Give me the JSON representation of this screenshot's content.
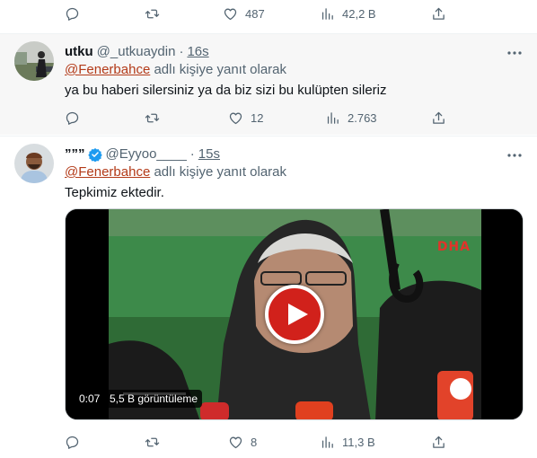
{
  "top_actions": {
    "replies": "",
    "retweets": "",
    "likes": "487",
    "views": "42,2 B"
  },
  "tweets": [
    {
      "name": "utku",
      "handle": "@_utkuaydin",
      "time": "16s",
      "reply_mention": "@Fenerbahce",
      "reply_suffix": " adlı kişiye yanıt olarak",
      "text": "ya bu haberi silersiniz ya da biz sizi bu kulüpten sileriz",
      "actions": {
        "replies": "",
        "retweets": "",
        "likes": "12",
        "views": "2.763"
      }
    },
    {
      "name": "”””",
      "handle": "@Eyyoo____",
      "time": "15s",
      "reply_mention": "@Fenerbahce",
      "reply_suffix": " adlı kişiye yanıt olarak",
      "text": "Tepkimiz ektedir.",
      "video": {
        "duration": "0:07",
        "views_label": "5,5 B görüntüleme",
        "watermark": "DHA"
      },
      "actions": {
        "replies": "",
        "retweets": "",
        "likes": "8",
        "views": "11,3 B"
      }
    }
  ],
  "colors": {
    "accent_link": "#b33a18",
    "secondary_text": "#536471",
    "verified_blue": "#1d9bf0",
    "play_red": "#d1211b"
  },
  "icons": [
    "reply-icon",
    "retweet-icon",
    "like-icon",
    "views-icon",
    "share-icon",
    "more-icon",
    "verified-icon",
    "play-icon"
  ]
}
